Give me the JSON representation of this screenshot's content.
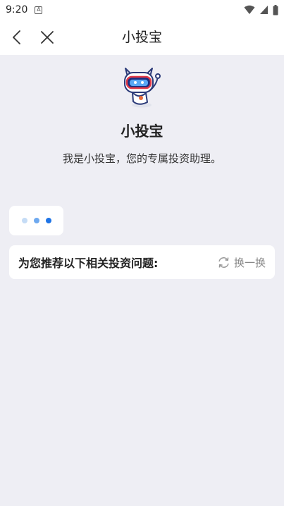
{
  "status_bar": {
    "time": "9:20",
    "notification_badge": "A",
    "icons": [
      "wifi-icon",
      "signal-icon",
      "battery-icon"
    ]
  },
  "nav": {
    "title": "小投宝",
    "back_icon": "chevron-left-icon",
    "close_icon": "close-icon"
  },
  "chat": {
    "bot_name": "小投宝",
    "bot_intro": "我是小投宝，您的专属投资助理。",
    "mascot_icon": "robot-cat-mascot",
    "typing_indicator": {
      "dot_colors": [
        "#c5dcf6",
        "#6ea9ef",
        "#1e74e6"
      ]
    },
    "suggestions": {
      "title": "为您推荐以下相关投资问题:",
      "refresh_label": "换一换",
      "refresh_icon": "refresh-icon"
    }
  },
  "colors": {
    "background": "#eeeef4",
    "card": "#ffffff",
    "accent_blue": "#1e74e6",
    "text_primary": "#222222",
    "text_muted": "#888888"
  }
}
